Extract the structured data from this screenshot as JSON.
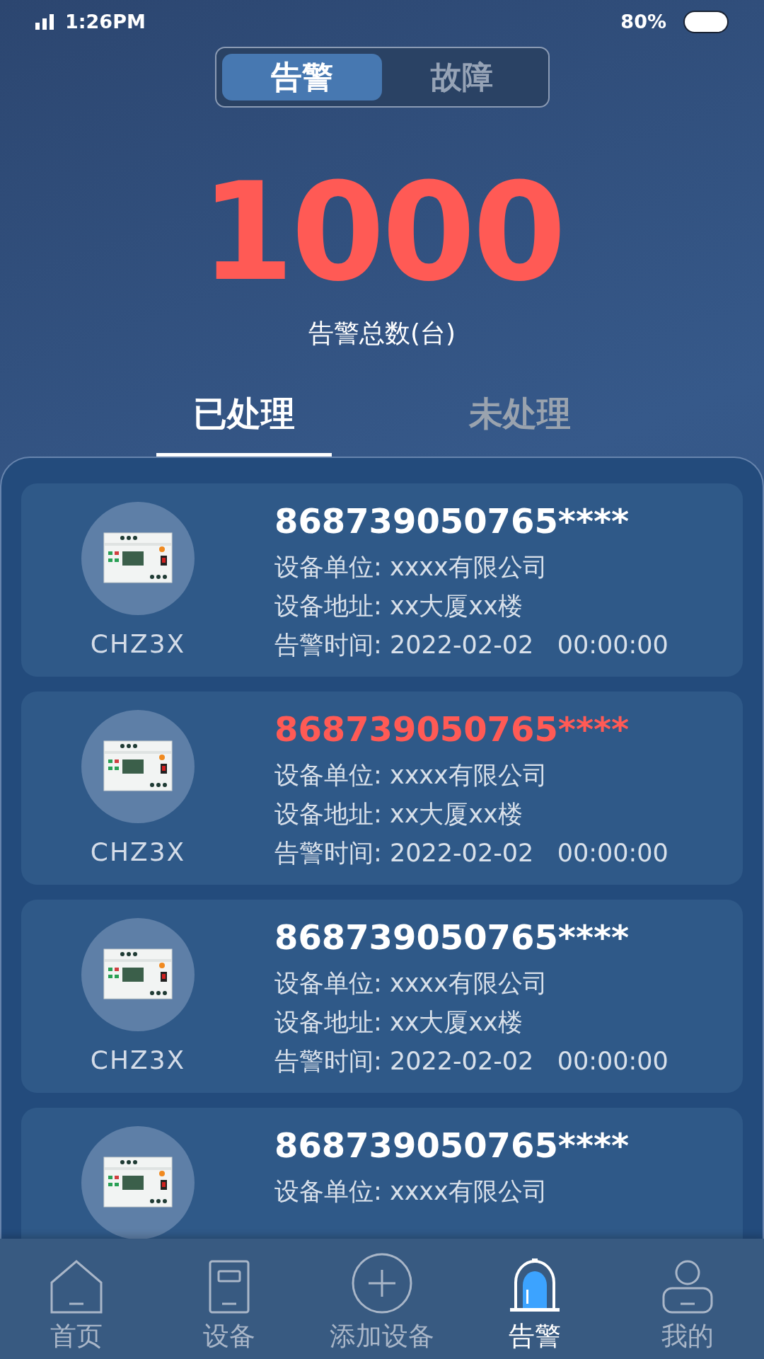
{
  "status_bar": {
    "time": "1:26PM",
    "battery": "80%"
  },
  "mode_toggle": [
    {
      "label": "告警",
      "selected": true
    },
    {
      "label": "故障",
      "selected": false
    }
  ],
  "summary": {
    "count": "1000",
    "label": "告警总数(台)"
  },
  "tabs": [
    {
      "label": "已处理",
      "selected": true
    },
    {
      "label": "未处理",
      "selected": false
    }
  ],
  "alarms": [
    {
      "model": "CHZ3X",
      "device_id": "868739050765****",
      "highlighted": false,
      "unit": "设备单位: xxxx有限公司",
      "address": "设备地址: xx大厦xx楼",
      "time": "告警时间: 2022-02-02   00:00:00"
    },
    {
      "model": "CHZ3X",
      "device_id": "868739050765****",
      "highlighted": true,
      "unit": "设备单位: xxxx有限公司",
      "address": "设备地址: xx大厦xx楼",
      "time": "告警时间: 2022-02-02   00:00:00"
    },
    {
      "model": "CHZ3X",
      "device_id": "868739050765****",
      "highlighted": false,
      "unit": "设备单位: xxxx有限公司",
      "address": "设备地址: xx大厦xx楼",
      "time": "告警时间: 2022-02-02   00:00:00"
    },
    {
      "device_id": "868739050765****",
      "highlighted": false,
      "unit": "设备单位: xxxx有限公司"
    }
  ],
  "bottom_nav": [
    {
      "label": "首页",
      "kind": "home",
      "selected": false
    },
    {
      "label": "设备",
      "kind": "device",
      "selected": false
    },
    {
      "label": "添加设备",
      "kind": "add",
      "selected": false
    },
    {
      "label": "告警",
      "kind": "alarm",
      "selected": true
    },
    {
      "label": "我的",
      "kind": "user",
      "selected": false
    }
  ]
}
